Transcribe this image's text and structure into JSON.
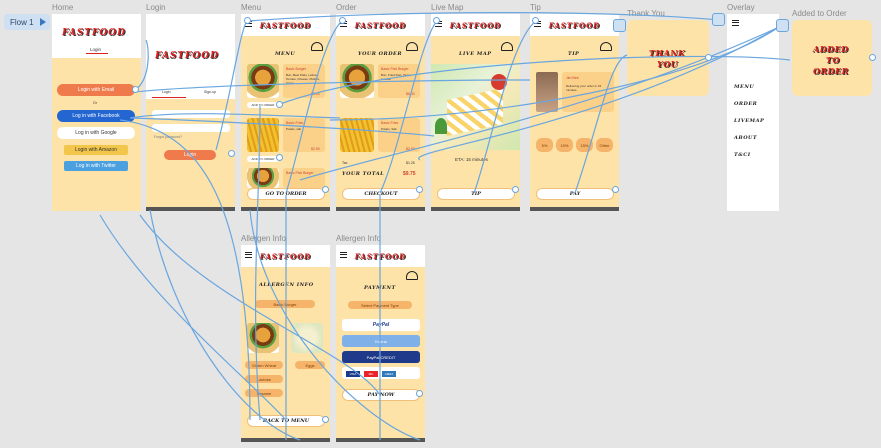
{
  "flow": {
    "label": "Flow 1"
  },
  "brand": {
    "logo": "FASTFOOD"
  },
  "frames": {
    "home": {
      "label": "Home",
      "tab": "Login",
      "btn_email": "Login with Email",
      "or": "Or",
      "btn_facebook": "Log in with Facebook",
      "btn_google": "Log in with Google",
      "btn_amazon": "Login with Amazon",
      "btn_twitter": "Log in with Twitter"
    },
    "login": {
      "label": "Login",
      "tab_login": "Login",
      "tab_signup": "Sign-up",
      "forgot": "Forgot password?",
      "btn_login": "Login"
    },
    "menu": {
      "label": "Menu",
      "title": "MENU",
      "item1_name": "Basic Burger",
      "item1_desc": "Bun, Beef Patty, Lettuce, Tomato, Cheese, Pickles, Onion",
      "item1_price": "$6.00",
      "item1_add": "ADD TO ORDER",
      "item2_name": "Basic Fries",
      "item2_desc": "Potato, salt",
      "item2_price": "$2.50",
      "item2_add": "ADD TO ORDER",
      "item3_name": "Basic Fish Burger",
      "btn": "GO TO ORDER"
    },
    "order": {
      "label": "Order",
      "title": "YOUR ORDER",
      "item1_name": "Basic Fish Burger",
      "item1_desc": "Bun, Fried Fish, Tartar, Lettuce",
      "item1_price": "$6.00",
      "item2_name": "Basic Fries",
      "item2_desc": "Potato, Salt",
      "item2_price": "$2.50",
      "tax_label": "Tax",
      "tax_value": "$1.25",
      "total_label": "YOUR TOTAL",
      "total_value": "$9.75",
      "btn": "CHECKOUT"
    },
    "livemap": {
      "label": "Live Map",
      "title": "LIVE MAP",
      "eta": "ETA: 15 minutes",
      "btn": "TIP"
    },
    "tip": {
      "label": "Tip",
      "title": "TIP",
      "driver_name": "Jim Bee",
      "driver_note": "Delivering your order in 15 minutes",
      "options": [
        "5%",
        "10%",
        "15%",
        "Other"
      ],
      "btn": "PAY"
    },
    "thankyou": {
      "label": "Thank You",
      "text1": "THANK",
      "text2": "YOU"
    },
    "overlay": {
      "label": "Overlay",
      "items": [
        "MENU",
        "ORDER",
        "LIVEMAP",
        "ABOUT",
        "T&CI"
      ]
    },
    "added": {
      "label": "Added to Order",
      "text1": "ADDED",
      "text2": "TO",
      "text3": "ORDER"
    },
    "allergen": {
      "label": "Allergen Info",
      "title": "ALLERGEN INFO",
      "item": "Basic Burger",
      "tags": [
        "Gluten Wheat",
        "Eggs",
        "Lactose",
        "Sesame"
      ],
      "btn": "BACK TO MENU"
    },
    "payment": {
      "label": "Allergen Info",
      "title": "PAYMENT",
      "select": "Select Payment Type",
      "paypal": "PayPal",
      "klarna": "Klarna",
      "paypal_credit": "PayPal CREDIT",
      "cards": [
        "VISA",
        "MC",
        "AMEX"
      ],
      "btn": "PAY NOW"
    }
  },
  "colors": {
    "accent": "#fde3a8",
    "wire": "#6aa6df",
    "brand": "#dd2222",
    "canvas": "#e5e5e5"
  }
}
